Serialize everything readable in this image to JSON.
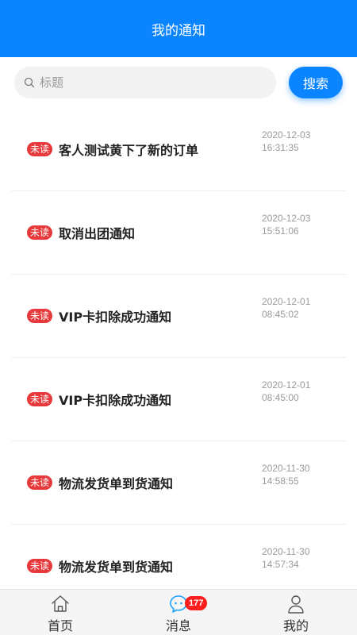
{
  "header": {
    "title": "我的通知"
  },
  "search": {
    "placeholder": "标题",
    "value": "",
    "button_label": "搜索"
  },
  "notifications": [
    {
      "badge": "未读",
      "title": "客人测试黄下了新的订单",
      "date": "2020-12-03",
      "time": "16:31:35"
    },
    {
      "badge": "未读",
      "title": "取消出团通知",
      "date": "2020-12-03",
      "time": "15:51:06"
    },
    {
      "badge": "未读",
      "title": "VIP卡扣除成功通知",
      "date": "2020-12-01",
      "time": "08:45:02"
    },
    {
      "badge": "未读",
      "title": "VIP卡扣除成功通知",
      "date": "2020-12-01",
      "time": "08:45:00"
    },
    {
      "badge": "未读",
      "title": "物流发货单到货通知",
      "date": "2020-11-30",
      "time": "14:58:55"
    },
    {
      "badge": "未读",
      "title": "物流发货单到货通知",
      "date": "2020-11-30",
      "time": "14:57:34"
    }
  ],
  "tabbar": {
    "items": [
      {
        "label": "首页",
        "icon": "home-icon"
      },
      {
        "label": "消息",
        "icon": "message-icon",
        "badge": "177"
      },
      {
        "label": "我的",
        "icon": "user-icon"
      }
    ]
  },
  "colors": {
    "primary": "#0a84ff",
    "unread_badge": "#e7393b",
    "count_badge": "#ff1e1e"
  }
}
